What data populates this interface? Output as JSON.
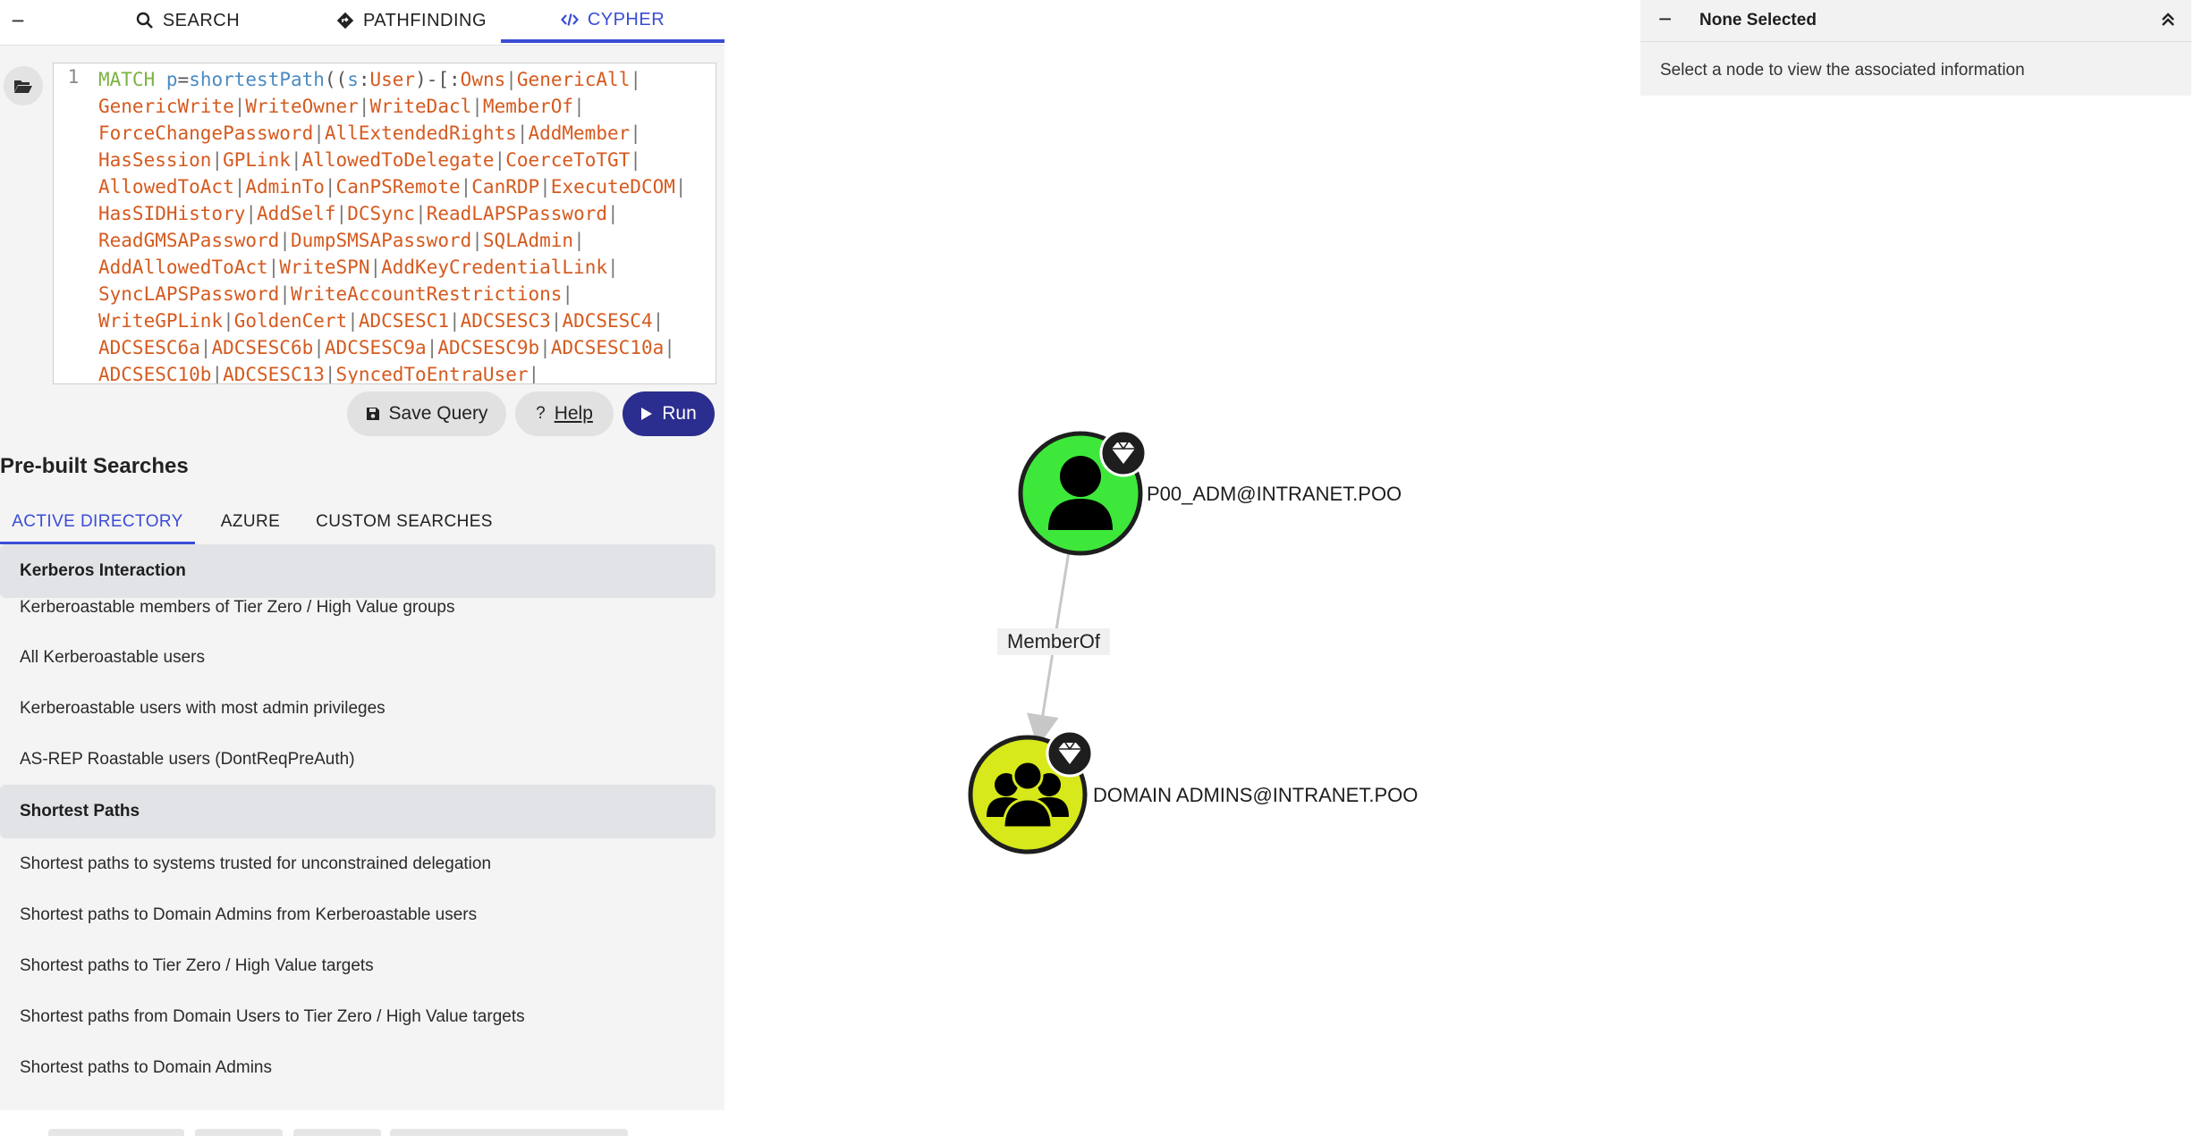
{
  "tabs": {
    "search": "SEARCH",
    "pathfinding": "PATHFINDING",
    "cypher": "CYPHER"
  },
  "editor": {
    "line_number": "1"
  },
  "buttons": {
    "save_query": "Save Query",
    "help": "Help",
    "run": "Run"
  },
  "prebuilt": {
    "title": "Pre-built Searches",
    "tabs": [
      "ACTIVE DIRECTORY",
      "AZURE",
      "CUSTOM SEARCHES"
    ],
    "sections": [
      {
        "header": "Kerberos Interaction",
        "items": [
          "Kerberoastable members of Tier Zero / High Value groups",
          "All Kerberoastable users",
          "Kerberoastable users with most admin privileges",
          "AS-REP Roastable users (DontReqPreAuth)"
        ]
      },
      {
        "header": "Shortest Paths",
        "items": [
          "Shortest paths to systems trusted for unconstrained delegation",
          "Shortest paths to Domain Admins from Kerberoastable users",
          "Shortest paths to Tier Zero / High Value targets",
          "Shortest paths from Domain Users to Tier Zero / High Value targets",
          "Shortest paths to Domain Admins"
        ]
      }
    ]
  },
  "graph": {
    "nodes": [
      {
        "label": "P00_ADM@INTRANET.POO",
        "kind": "user",
        "color": "#3ee83a"
      },
      {
        "label": "DOMAIN ADMINS@INTRANET.POO",
        "kind": "group",
        "color": "#d7e81b"
      }
    ],
    "edge_label": "MemberOf"
  },
  "info_panel": {
    "title": "None Selected",
    "message": "Select a node to view the associated information"
  },
  "colors": {
    "accent": "#3a4cd6",
    "run_button": "#2b2d8f",
    "relationship": "#d55a1f",
    "keyword": "#7bb342"
  }
}
